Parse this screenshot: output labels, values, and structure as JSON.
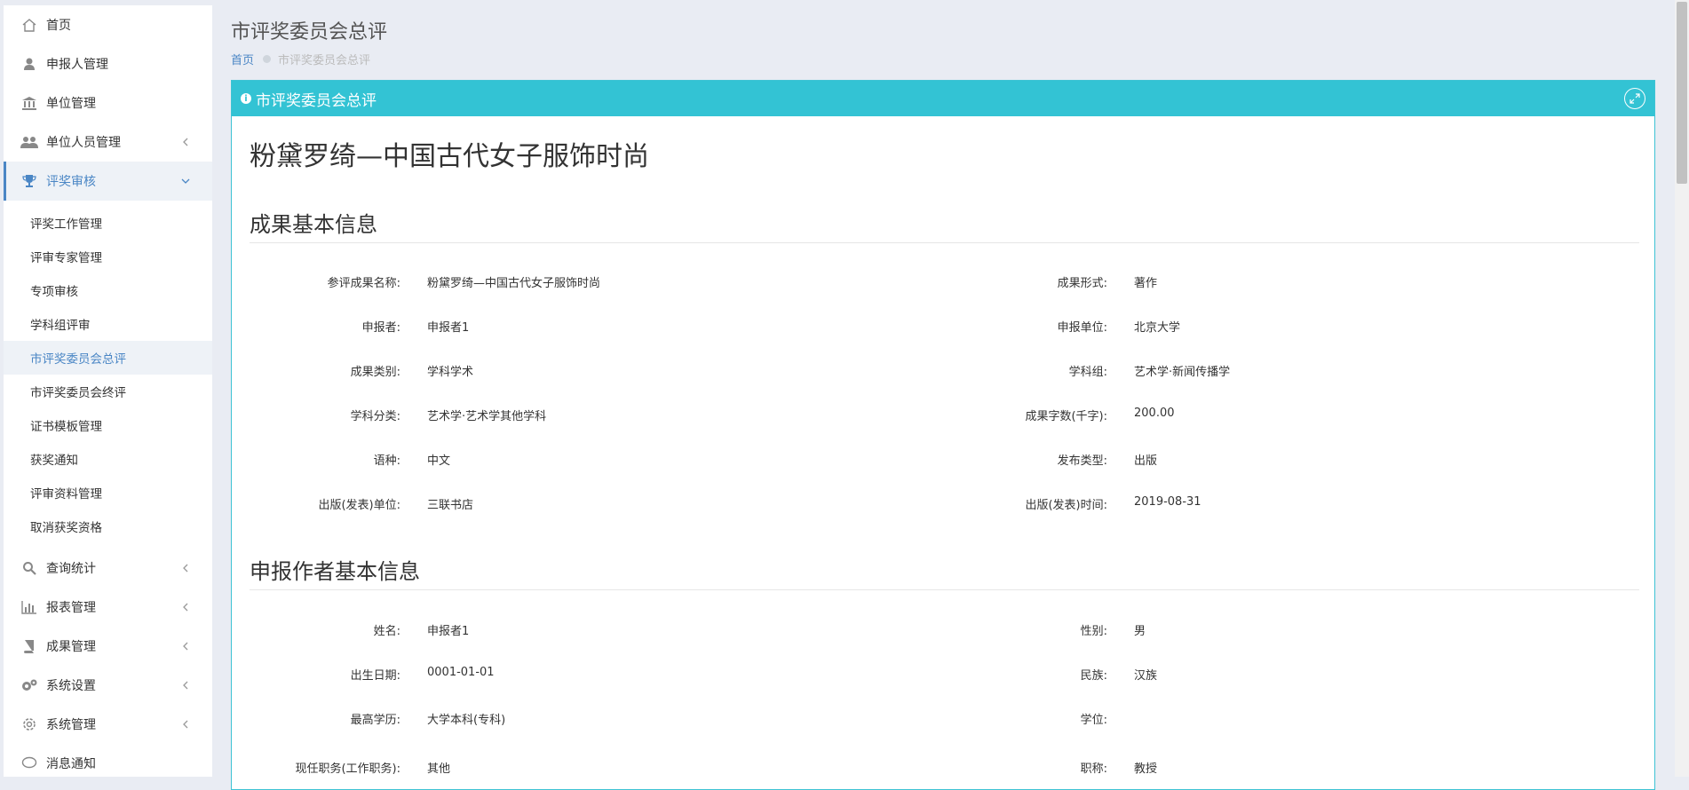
{
  "sidebar": {
    "items": [
      {
        "label": "首页",
        "icon": "home-icon"
      },
      {
        "label": "申报人管理",
        "icon": "user-icon"
      },
      {
        "label": "单位管理",
        "icon": "bank-icon"
      },
      {
        "label": "单位人员管理",
        "icon": "users-icon"
      },
      {
        "label": "评奖审核",
        "icon": "trophy-icon"
      },
      {
        "label": "查询统计",
        "icon": "search-icon"
      },
      {
        "label": "报表管理",
        "icon": "bar-chart-icon"
      },
      {
        "label": "成果管理",
        "icon": "book-icon"
      },
      {
        "label": "系统设置",
        "icon": "gears-icon"
      },
      {
        "label": "系统管理",
        "icon": "gear-icon"
      },
      {
        "label": "消息通知",
        "icon": "message-icon"
      }
    ],
    "sub_items": [
      "评奖工作管理",
      "评审专家管理",
      "专项审核",
      "学科组评审",
      "市评奖委员会总评",
      "市评奖委员会终评",
      "证书模板管理",
      "获奖通知",
      "评审资料管理",
      "取消获奖资格"
    ]
  },
  "header": {
    "title": "市评奖委员会总评",
    "breadcrumb": {
      "home": "首页",
      "current": "市评奖委员会总评"
    }
  },
  "panel": {
    "title": "市评奖委员会总评",
    "doc_title": "粉黛罗绮—中国古代女子服饰时尚",
    "section1": {
      "title": "成果基本信息",
      "rows": [
        {
          "label": "参评成果名称:",
          "value": "粉黛罗绮—中国古代女子服饰时尚",
          "label2": "成果形式:",
          "value2": "著作"
        },
        {
          "label": "申报者:",
          "value": "申报者1",
          "label2": "申报单位:",
          "value2": "北京大学"
        },
        {
          "label": "成果类别:",
          "value": "学科学术",
          "label2": "学科组:",
          "value2": "艺术学·新闻传播学"
        },
        {
          "label": "学科分类:",
          "value": "艺术学·艺术学其他学科",
          "label2": "成果字数(千字):",
          "value2": "200.00"
        },
        {
          "label": "语种:",
          "value": "中文",
          "label2": "发布类型:",
          "value2": "出版"
        },
        {
          "label": "出版(发表)单位:",
          "value": "三联书店",
          "label2": "出版(发表)时间:",
          "value2": "2019-08-31"
        }
      ]
    },
    "section2": {
      "title": "申报作者基本信息",
      "rows": [
        {
          "label": "姓名:",
          "value": "申报者1",
          "label2": "性别:",
          "value2": "男"
        },
        {
          "label": "出生日期:",
          "value": "0001-01-01",
          "label2": "民族:",
          "value2": "汉族"
        },
        {
          "label": "最高学历:",
          "value": "大学本科(专科)",
          "label2": "学位:",
          "value2": ""
        },
        {
          "label": "现任职务(工作职务):",
          "value": "其他",
          "label2": "职称:",
          "value2": "教授"
        }
      ]
    }
  }
}
